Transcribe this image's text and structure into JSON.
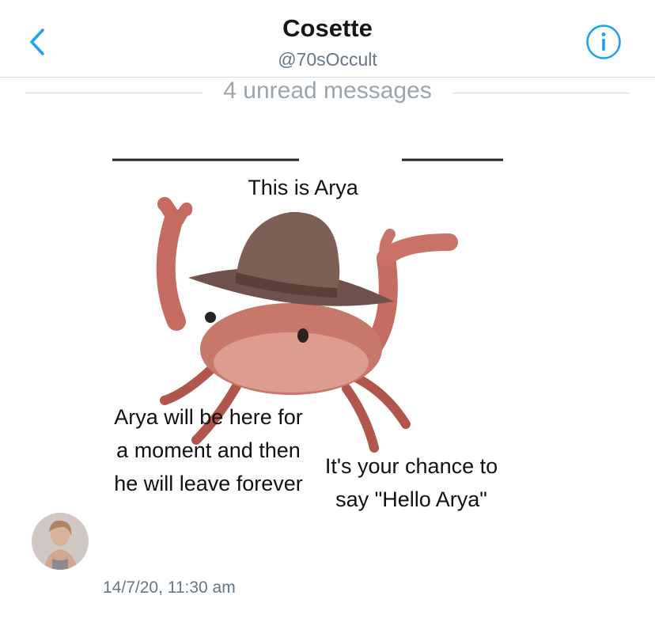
{
  "header": {
    "back_icon": "chevron-left-icon",
    "title": "Cosette",
    "handle": "@70sOccult",
    "info_icon": "info-icon"
  },
  "divider": {
    "label": "4 unread messages"
  },
  "message": {
    "meme_texts": {
      "title": "This is Arya",
      "left": "Arya will be here for a moment and then he will leave forever",
      "right": "It's your chance to say \"Hello Arya\""
    },
    "timestamp": "14/7/20, 11:30 am"
  },
  "colors": {
    "accent": "#1da1f2",
    "muted": "#657786",
    "divider_text": "#9aa5b0"
  }
}
